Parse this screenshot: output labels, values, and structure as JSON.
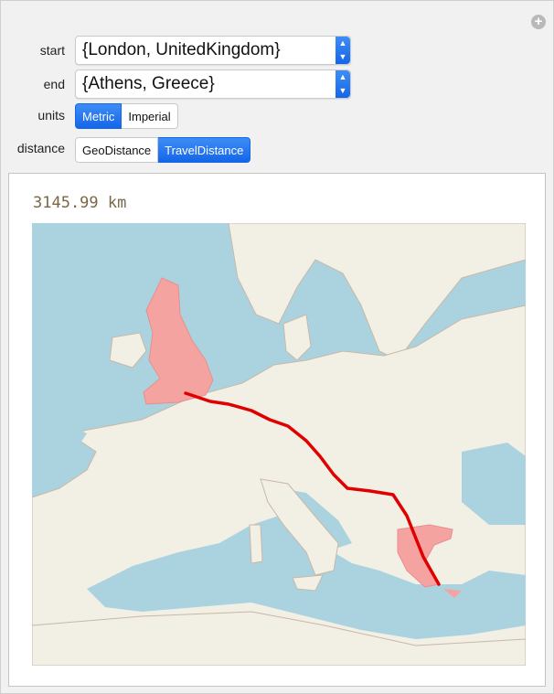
{
  "controls": {
    "start": {
      "label": "start",
      "value": "{London, UnitedKingdom}"
    },
    "end": {
      "label": "end",
      "value": "{Athens, Greece}"
    },
    "units": {
      "label": "units",
      "options": [
        "Metric",
        "Imperial"
      ],
      "selected": "Metric"
    },
    "distance": {
      "label": "distance",
      "options": [
        "GeoDistance",
        "TravelDistance"
      ],
      "selected": "TravelDistance"
    }
  },
  "output": {
    "distance_text": "3145.99 km"
  },
  "map": {
    "route": {
      "from": "London",
      "to": "Athens",
      "color": "#e00000"
    },
    "highlight_color": "#f4a3a0",
    "land_color": "#f2efe4",
    "sea_color": "#aad3df"
  }
}
